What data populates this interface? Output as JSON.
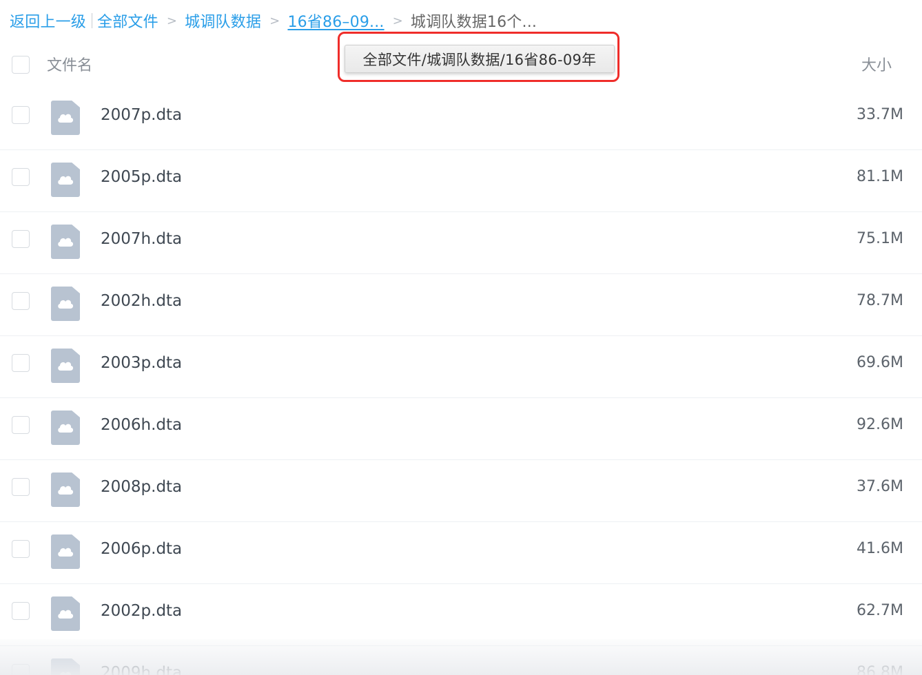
{
  "breadcrumb": {
    "back": "返回上一级",
    "items": [
      {
        "label": "全部文件"
      },
      {
        "label": "城调队数据"
      },
      {
        "label": "16省86–09..."
      }
    ],
    "separator": ">",
    "current": "城调队数据16个..."
  },
  "header": {
    "name_column": "文件名",
    "size_column": "大小"
  },
  "tooltip": {
    "text": "全部文件/城调队数据/16省86-09年"
  },
  "files": [
    {
      "name": "2007p.dta",
      "size": "33.7M",
      "icon": "file-cloud-icon"
    },
    {
      "name": "2005p.dta",
      "size": "81.1M",
      "icon": "file-cloud-icon"
    },
    {
      "name": "2007h.dta",
      "size": "75.1M",
      "icon": "file-cloud-icon"
    },
    {
      "name": "2002h.dta",
      "size": "78.7M",
      "icon": "file-cloud-icon"
    },
    {
      "name": "2003p.dta",
      "size": "69.6M",
      "icon": "file-cloud-icon"
    },
    {
      "name": "2006h.dta",
      "size": "92.6M",
      "icon": "file-cloud-icon"
    },
    {
      "name": "2008p.dta",
      "size": "37.6M",
      "icon": "file-cloud-icon"
    },
    {
      "name": "2006p.dta",
      "size": "41.6M",
      "icon": "file-cloud-icon"
    },
    {
      "name": "2002p.dta",
      "size": "62.7M",
      "icon": "file-cloud-icon"
    },
    {
      "name": "2009h.dta",
      "size": "86.8M",
      "icon": "file-cloud-icon"
    }
  ],
  "colors": {
    "link": "#2a9ee8",
    "highlight": "#ef2d2a",
    "file_icon": "#b8c3d1"
  }
}
